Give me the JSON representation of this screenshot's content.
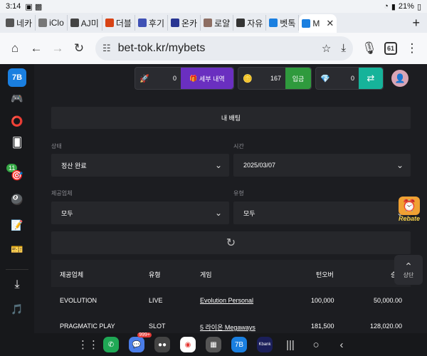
{
  "status": {
    "time": "3:14",
    "battery": "21%"
  },
  "tabs": [
    {
      "label": "네카",
      "color": "#555"
    },
    {
      "label": "iClo",
      "color": "#777"
    },
    {
      "label": "AJ미",
      "color": "#444"
    },
    {
      "label": "더블",
      "color": "#d84315"
    },
    {
      "label": "후기",
      "color": "#3f51b5"
    },
    {
      "label": "온카",
      "color": "#283593"
    },
    {
      "label": "로얄",
      "color": "#8d6e63"
    },
    {
      "label": "자유",
      "color": "#333"
    },
    {
      "label": "벳톡",
      "color": "#1a7fe0"
    },
    {
      "label": "M",
      "color": "#1a7fe0"
    }
  ],
  "browser": {
    "url": "bet-tok.kr/mybets",
    "tab_count": "61"
  },
  "wallets": {
    "points": {
      "amount": "0",
      "button": "세부 내역"
    },
    "coins": {
      "amount": "167",
      "button": "입금"
    },
    "gems": {
      "amount": "0"
    }
  },
  "page": {
    "title": "내 배팅"
  },
  "filters": {
    "status_label": "상태",
    "status_value": "정산 완료",
    "time_label": "시간",
    "time_value": "2025/03/07",
    "provider_label": "제공업체",
    "provider_value": "모두",
    "type_label": "유형",
    "type_value": "모두"
  },
  "table": {
    "headers": [
      "제공업체",
      "유형",
      "게임",
      "턴오버",
      "승"
    ],
    "rows": [
      {
        "provider": "EVOLUTION",
        "type": "LIVE",
        "game": "Evolution Personal",
        "turnover": "100,000",
        "win": "50,000.00"
      },
      {
        "provider": "PRAGMATIC PLAY",
        "type": "SLOT",
        "game": "5 라이온 Megaways",
        "turnover": "181,500",
        "win": "128,020.00"
      }
    ]
  },
  "widgets": {
    "rebate": "Rebate",
    "scroll_top": "상단"
  },
  "sidebar": {
    "logo": "7B",
    "badge": "11"
  },
  "nav": {
    "messages_badge": "999+",
    "kbank": "Kbank"
  }
}
